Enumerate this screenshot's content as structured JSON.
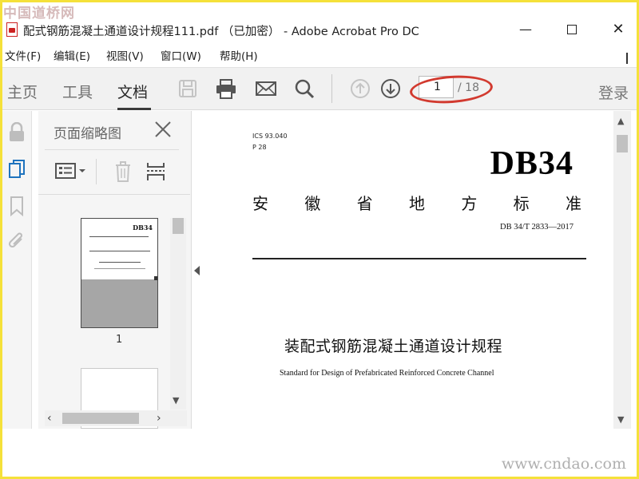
{
  "watermarks": {
    "top": "中国道桥网",
    "bottom": "www.cndao.com"
  },
  "window": {
    "title": "配式钢筋混凝土通道设计规程111.pdf （已加密） - Adobe Acrobat Pro DC"
  },
  "menu": {
    "file": "文件(F)",
    "edit": "编辑(E)",
    "view": "视图(V)",
    "window": "窗口(W)",
    "help": "帮助(H)"
  },
  "toolbar": {
    "tabs": {
      "home": "主页",
      "tools": "工具",
      "document": "文档"
    },
    "page_current": "1",
    "page_total": "/ 18",
    "login": "登录",
    "icons": [
      "save-icon",
      "print-icon",
      "mail-icon",
      "search-icon",
      "arrow-up-icon",
      "arrow-down-icon"
    ]
  },
  "thumbnails_panel": {
    "title": "页面缩略图",
    "page_label": "1",
    "thumb_db": "DB34"
  },
  "document": {
    "ics": "ICS 93.040",
    "p": "P 28",
    "db": "DB34",
    "standard_chars": [
      "安",
      "徽",
      "省",
      "地",
      "方",
      "标",
      "准"
    ],
    "std_number": "DB 34/T 2833—2017",
    "title_cn": "装配式钢筋混凝土通道设计规程",
    "title_en": "Standard for Design of Prefabricated Reinforced Concrete Channel"
  },
  "colors": {
    "highlight_ellipse": "#d23a2f",
    "frame": "#f5e13a",
    "toolbar_bg": "#f1f1f1"
  }
}
